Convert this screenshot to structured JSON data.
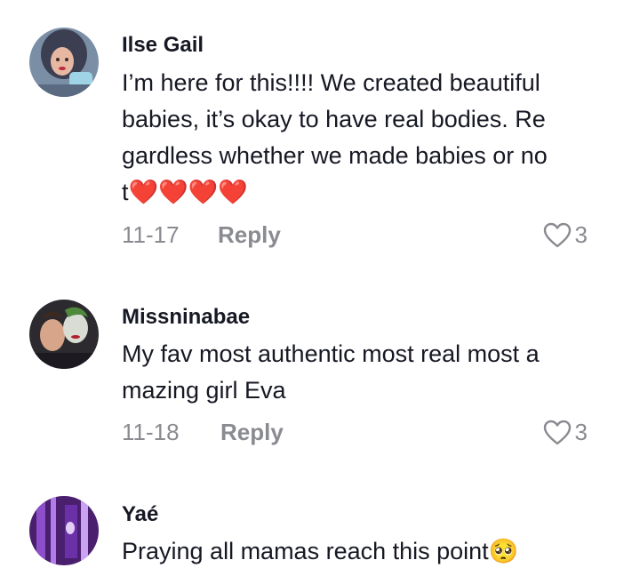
{
  "comments": [
    {
      "username": "Ilse Gail",
      "text": "I’m here for this!!!! We created beautiful\nbabies, it’s okay to have real bodies. Re\ngardless whether we made babies or no\nt❤️❤️❤️❤️",
      "date": "11-17",
      "reply_label": "Reply",
      "likes": "3"
    },
    {
      "username": "Missninabae",
      "text": "My fav most authentic most real most a\nmazing girl Eva",
      "date": "11-18",
      "reply_label": "Reply",
      "likes": "3"
    },
    {
      "username": "Yaé",
      "text": "Praying all mamas reach this point🥺",
      "date": "",
      "reply_label": "",
      "likes": ""
    }
  ],
  "colors": {
    "text": "#161823",
    "muted": "#8a8b91",
    "heart": "#e0102d"
  },
  "icons": {
    "like": "heart-outline-icon"
  }
}
